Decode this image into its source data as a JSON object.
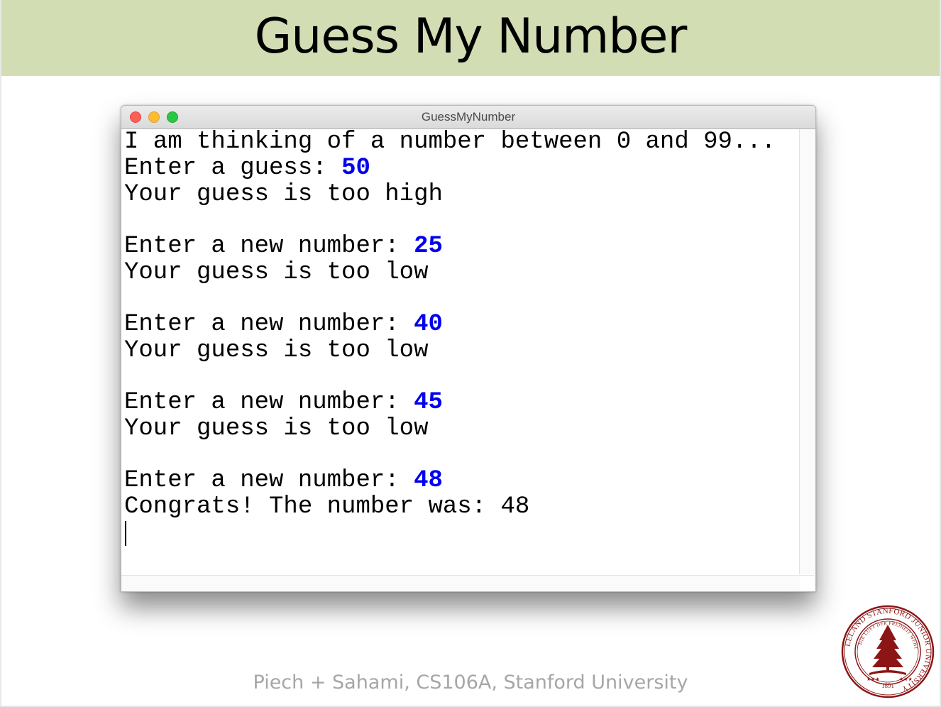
{
  "slide": {
    "title": "Guess My Number",
    "footer": "Piech + Sahami, CS106A, Stanford University",
    "title_band_color": "#d2ddb4"
  },
  "window": {
    "title": "GuessMyNumber",
    "controls": [
      "close",
      "minimize",
      "maximize"
    ]
  },
  "console": {
    "intro": "I am thinking of a number between 0 and 99...",
    "entries": [
      {
        "prompt": "Enter a guess: ",
        "value": "50",
        "response": "Your guess is too high"
      },
      {
        "prompt": "Enter a new number: ",
        "value": "25",
        "response": "Your guess is too low"
      },
      {
        "prompt": "Enter a new number: ",
        "value": "40",
        "response": "Your guess is too low"
      },
      {
        "prompt": "Enter a new number: ",
        "value": "45",
        "response": "Your guess is too low"
      },
      {
        "prompt": "Enter a new number: ",
        "value": "48",
        "response": "Congrats! The number was: 48"
      }
    ],
    "input_color": "#0000ee"
  },
  "seal": {
    "text_outer": "LELAND STANFORD JUNIOR UNIVERSITY",
    "text_inner": "DIE LUFT DER FREIHEIT WEHT",
    "year": "1891",
    "color": "#8c1515"
  }
}
